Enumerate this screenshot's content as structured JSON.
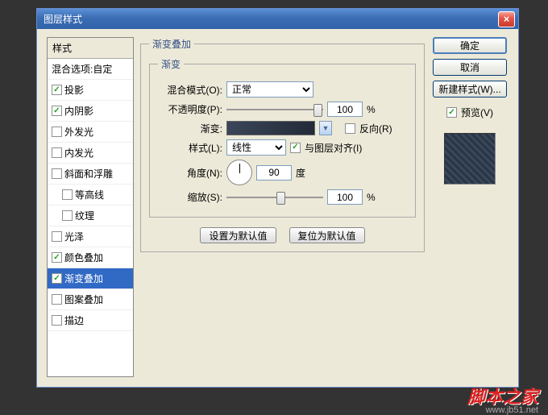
{
  "dialog": {
    "title": "图层样式"
  },
  "styles_panel": {
    "header": "样式",
    "blend_options": "混合选项:自定",
    "items": [
      {
        "label": "投影",
        "checked": true
      },
      {
        "label": "内阴影",
        "checked": true
      },
      {
        "label": "外发光",
        "checked": false
      },
      {
        "label": "内发光",
        "checked": false
      },
      {
        "label": "斜面和浮雕",
        "checked": false
      },
      {
        "label": "等高线",
        "checked": false,
        "indent": true
      },
      {
        "label": "纹理",
        "checked": false,
        "indent": true
      },
      {
        "label": "光泽",
        "checked": false
      },
      {
        "label": "颜色叠加",
        "checked": true
      },
      {
        "label": "渐变叠加",
        "checked": true,
        "selected": true
      },
      {
        "label": "图案叠加",
        "checked": false
      },
      {
        "label": "描边",
        "checked": false
      }
    ]
  },
  "gradient_overlay": {
    "section_title": "渐变叠加",
    "group_title": "渐变",
    "blend_mode_label": "混合模式(O):",
    "blend_mode_value": "正常",
    "opacity_label": "不透明度(P):",
    "opacity_value": "100",
    "percent": "%",
    "gradient_label": "渐变:",
    "reverse_label": "反向(R)",
    "reverse_checked": false,
    "style_label": "样式(L):",
    "style_value": "线性",
    "align_label": "与图层对齐(I)",
    "align_checked": true,
    "angle_label": "角度(N):",
    "angle_value": "90",
    "degree": "度",
    "scale_label": "缩放(S):",
    "scale_value": "100",
    "set_default": "设置为默认值",
    "reset_default": "复位为默认值"
  },
  "actions": {
    "ok": "确定",
    "cancel": "取消",
    "new_style": "新建样式(W)...",
    "preview_label": "预览(V)",
    "preview_checked": true
  },
  "watermark": {
    "text": "脚本之家",
    "url": "www.jb51.net"
  }
}
